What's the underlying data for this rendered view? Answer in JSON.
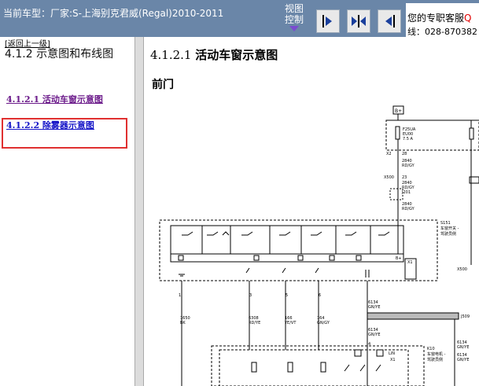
{
  "topbar": {
    "title": "当前车型：厂家:S-上海别克君威(Regal)2010-2011",
    "view_control_line1": "视图",
    "view_control_line2": "控制",
    "buttons": [
      {
        "name": "show-right-panel-icon"
      },
      {
        "name": "split-panels-icon"
      },
      {
        "name": "show-left-panel-icon"
      }
    ],
    "service_line1": "您的专职客服",
    "service_q": "Q",
    "service_line2": "线：028-870382"
  },
  "sidebar": {
    "back_link": "[返回上一级]",
    "heading": "4.1.2 示意图和布线图",
    "items": [
      {
        "label": "4.1.2.1 活动车窗示意图",
        "state": "visited"
      },
      {
        "label": "4.1.2.2 除雾器示意图",
        "state": "normal"
      }
    ]
  },
  "content": {
    "section_number": "4.1.2.1",
    "section_title": "活动车窗示意图",
    "subtitle": "前门",
    "diagram": {
      "labels": {
        "bplus": "B+",
        "fuse_name": "F25UA",
        "fuse_id": "EU00",
        "fuse_rating": "7.5 A",
        "x2": "X2",
        "x2_pin": "28",
        "x2_wire": "2840",
        "x2_color": "RD/GY",
        "x500": "X500",
        "x500_pin": "23",
        "x500_wire": "2840",
        "x500_color": "RD/GY",
        "j201": "J201",
        "wire_2840": "2840",
        "wire_2840_color": "RD/GY",
        "module_id": "S151",
        "module_line1": "车窗开关 -",
        "module_line2": "驾驶员侧",
        "bplus_pin": "B+",
        "x1": "X1",
        "x500_right": "X500",
        "pin1": "1",
        "pin3": "3",
        "pin5": "5",
        "pin6": "6",
        "w1_num": "1650",
        "w1_col": "BK",
        "w2_num": "6308",
        "w2_col": "RD/YE",
        "w3_num": "166",
        "w3_col": "YE/VT",
        "w4_num": "164",
        "w4_col": "GN/GY",
        "w5_num": "6134",
        "w5_col": "GN/YE",
        "w6_num": "6134",
        "w6_col": "GN/YE",
        "j509": "J509",
        "w7_num": "6134",
        "w7_col": "GN/YE",
        "m_pin4": "4",
        "k10": "K10",
        "k10_line1": "车窗电机 -",
        "k10_line2": "驾驶员侧",
        "x1_k": "X1",
        "w8_num": "6134",
        "w8_col": "GN/YE",
        "lin": "LIN"
      }
    }
  }
}
